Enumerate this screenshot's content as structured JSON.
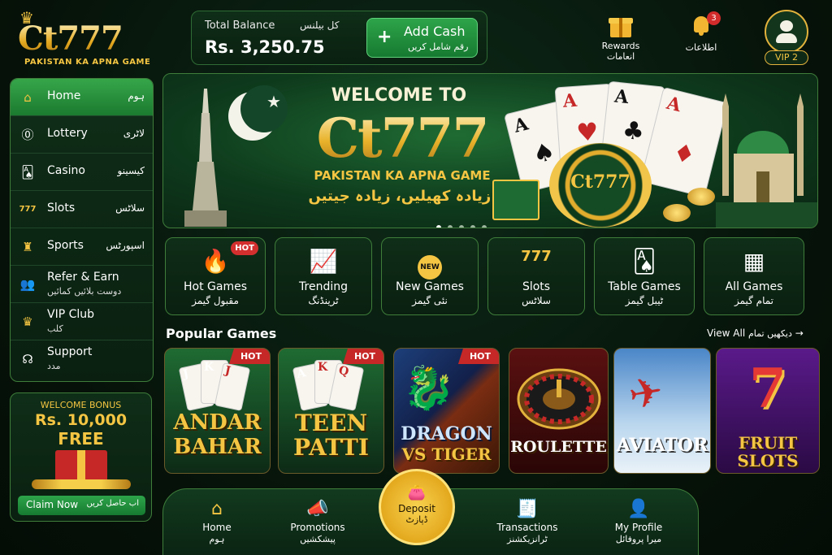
{
  "brand": {
    "logo_text": "Ct777",
    "tagline": "PAKISTAN KA APNA GAME"
  },
  "balance": {
    "label": "Total Balance",
    "label_ur": "کل بیلنس",
    "amount": "Rs. 3,250.75",
    "add_cash": "Add Cash",
    "add_cash_ur": "رقم شامل کریں"
  },
  "header": {
    "rewards": "Rewards",
    "rewards_ur": "انعامات",
    "notifications_ur": "اطلاعات",
    "notification_count": "3",
    "vip_level": "VIP 2"
  },
  "sidebar": {
    "items": [
      {
        "label": "Home",
        "label_ur": "ہوم",
        "icon": "home-icon"
      },
      {
        "label": "Lottery",
        "label_ur": "لاٹری",
        "icon": "lottery-icon"
      },
      {
        "label": "Casino",
        "label_ur": "کیسینو",
        "icon": "casino-icon"
      },
      {
        "label": "Slots",
        "label_ur": "سلاٹس",
        "icon": "slots-icon"
      },
      {
        "label": "Sports",
        "label_ur": "اسپورٹس",
        "icon": "trophy-icon"
      },
      {
        "label": "Refer & Earn",
        "label_ur": "دوست بلائیں کمائیں",
        "icon": "users-icon"
      },
      {
        "label": "VIP Club",
        "label_ur": "کلب",
        "icon": "crown-icon"
      },
      {
        "label": "Support",
        "label_ur": "مدد",
        "icon": "headset-icon"
      }
    ]
  },
  "bonus": {
    "title": "WELCOME BONUS",
    "amount": "Rs. 10,000",
    "free": "FREE",
    "claim": "Claim Now",
    "claim_ur": "اب حاصل کریں"
  },
  "hero": {
    "welcome": "WELCOME TO",
    "brand": "Ct777",
    "tagline": "PAKISTAN KA APNA GAME",
    "tagline_ur": "زیادہ کھیلیں، زیادہ جیتیں!",
    "chip_text": "Ct777",
    "slides": 5,
    "active_slide": 0
  },
  "categories": [
    {
      "label": "Hot Games",
      "label_ur": "مقبول گیمز",
      "icon": "flame-icon",
      "badge": "HOT"
    },
    {
      "label": "Trending",
      "label_ur": "ٹرینڈنگ",
      "icon": "trending-icon"
    },
    {
      "label": "New Games",
      "label_ur": "نئی گیمز",
      "icon": "new-icon",
      "badge": "NEW"
    },
    {
      "label": "Slots",
      "label_ur": "سلاٹس",
      "icon": "slot-777-icon",
      "icon_text": "777"
    },
    {
      "label": "Table Games",
      "label_ur": "ٹیبل گیمز",
      "icon": "cards-icon"
    },
    {
      "label": "All Games",
      "label_ur": "تمام گیمز",
      "icon": "grid-icon"
    }
  ],
  "popular": {
    "title": "Popular Games",
    "view_all": "View All",
    "view_all_ur": "دیکھیں تمام",
    "games": [
      {
        "line1": "ANDAR",
        "line2": "BAHAR",
        "badge": "HOT"
      },
      {
        "line1": "TEEN",
        "line2": "PATTI",
        "badge": "HOT"
      },
      {
        "line1": "DRAGON",
        "line2": "VS TIGER",
        "badge": "HOT"
      },
      {
        "line1": "ROULETTE",
        "line2": ""
      },
      {
        "line1": "AVIATOR",
        "line2": ""
      },
      {
        "line1": "FRUIT",
        "line2": "SLOTS"
      }
    ]
  },
  "bottom_nav": {
    "home": "Home",
    "home_ur": "ہوم",
    "promotions": "Promotions",
    "promotions_ur": "پیشکشیں",
    "deposit": "Deposit",
    "deposit_ur": "ڈپازٹ",
    "transactions": "Transactions",
    "transactions_ur": "ٹرانزیکشنز",
    "profile": "My Profile",
    "profile_ur": "میرا پروفائل"
  },
  "colors": {
    "accent": "#f4c542",
    "primary_green": "#1b7a2f",
    "background": "#061209",
    "hot": "#c62828"
  }
}
